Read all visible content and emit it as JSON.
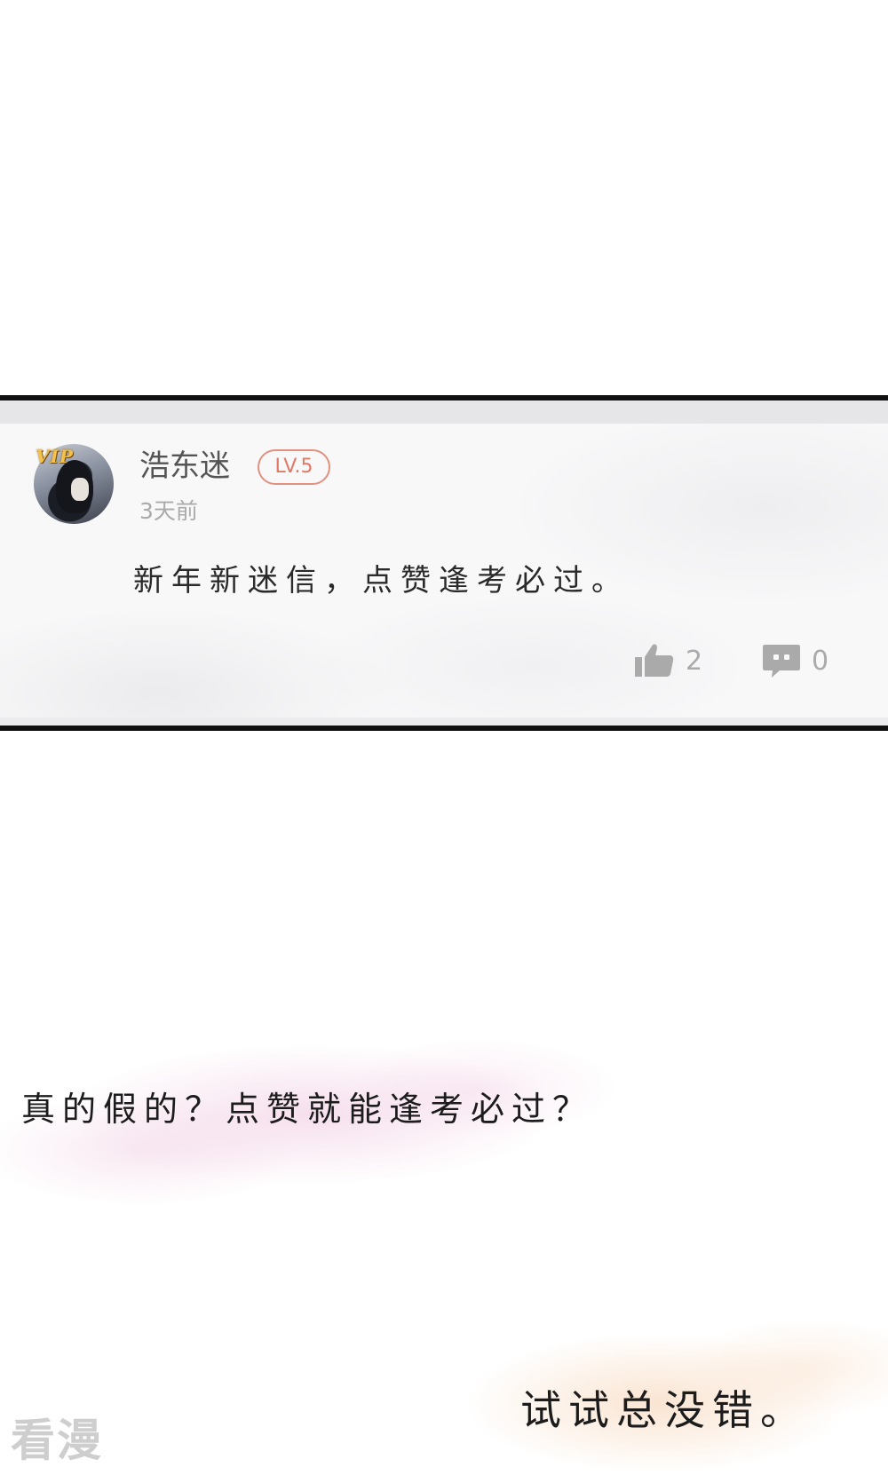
{
  "comment": {
    "vip_label": "VIP",
    "username": "浩东迷",
    "level": "LV.5",
    "timestamp": "3天前",
    "text": "新年新迷信，点赞逢考必过。",
    "like_count": "2",
    "reply_count": "0"
  },
  "captions": {
    "question": "真的假的？点赞就能逢考必过？",
    "answer": "试试总没错。"
  },
  "watermark": "看漫",
  "icons": {
    "like": "thumbs-up-icon",
    "reply": "comment-bubble-icon"
  },
  "colors": {
    "level_badge": "#e07a66",
    "muted_text": "#aaaaaa",
    "vip_gold": "#f4c24a"
  }
}
